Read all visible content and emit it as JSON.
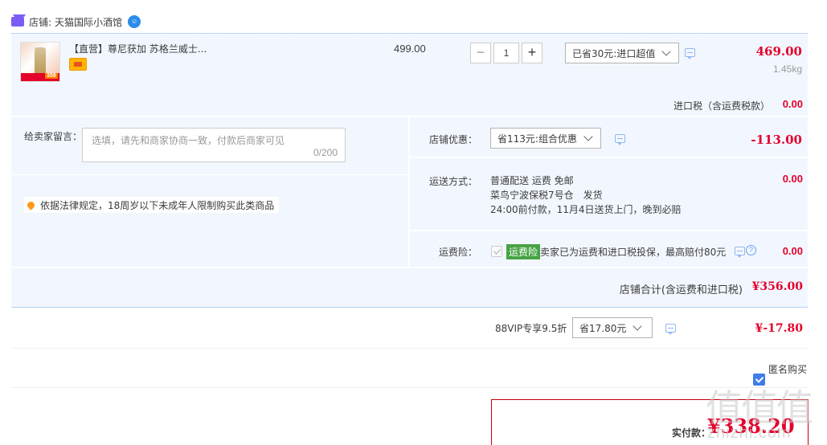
{
  "shop": {
    "label": "店铺:",
    "name": "天猫国际小酒馆"
  },
  "item": {
    "title": "【直营】尊尼获加 苏格兰威士...",
    "thumb_badge": "359",
    "unit_price": "499.00",
    "quantity": "1",
    "discount_select": "已省30元:进口超值",
    "total": "469.00",
    "weight": "1.45kg",
    "tax_label": "进口税（含运费税款）",
    "tax_value": "0.00"
  },
  "seller_message": {
    "label": "给卖家留言：",
    "placeholder": "选填，请先和商家协商一致，付款后商家可见",
    "counter": "0/200"
  },
  "notice": "依据法律规定，18周岁以下未成年人限制购买此类商品",
  "shop_discount": {
    "label": "店铺优惠：",
    "select": "省113元:组合优惠",
    "value": "-113.00"
  },
  "shipping": {
    "label": "运送方式：",
    "line1": "普通配送 运费 免邮",
    "line2": "菜鸟宁波保税7号仓　发货",
    "line3": "24:00前付款，11月4日送货上门，晚到必赔",
    "value": "0.00"
  },
  "insurance": {
    "label": "运费险：",
    "tag": "运费险",
    "text": "卖家已为运费和进口税投保，最高赔付80元",
    "value": "0.00"
  },
  "shop_total": {
    "label": "店铺合计(含运费和进口税)",
    "value": "¥356.00"
  },
  "vip": {
    "label": "88VIP专享9.5折",
    "select": "省17.80元",
    "value": "¥-17.80"
  },
  "anonymous": {
    "label": "匿名购买",
    "checked": true
  },
  "payment": {
    "label": "实付款：",
    "value": "¥338.20"
  },
  "watermark": {
    "glyphs": "值值值",
    "site": "zhizhi.com"
  },
  "colors": {
    "accent": "#e4002b",
    "panel": "#f2f7ff",
    "checkbox": "#3f7de8",
    "tag": "#47a343"
  }
}
